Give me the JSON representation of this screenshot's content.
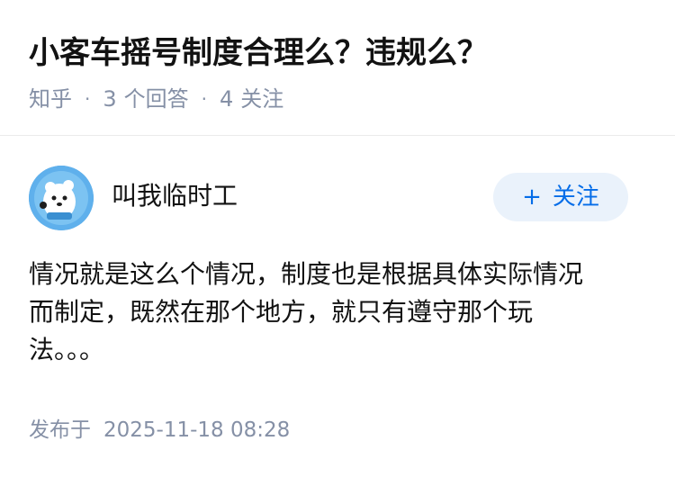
{
  "question": {
    "title": "小客车摇号制度合理么？违规么？",
    "source": "知乎",
    "answer_count": "3",
    "answer_unit": "个回答",
    "follower_count": "4",
    "follower_unit": "关注",
    "separator": "·"
  },
  "answer": {
    "author": {
      "name": "叫我临时工",
      "avatar_icon": "avatar-icon"
    },
    "follow_button": {
      "plus": "+",
      "label": "关注"
    },
    "content_lines": [
      "情况就是这么个情况，制度也是根据具体实际情况",
      "而制定，既然在那个地方，就只有遵守那个玩",
      "法。。。"
    ],
    "published_label": "发布于",
    "published_time": "2025-11-18 08:28"
  },
  "colors": {
    "accent": "#056de8",
    "button_bg": "#eaf2fb",
    "meta_gray": "#8590a6",
    "text": "#121212"
  }
}
